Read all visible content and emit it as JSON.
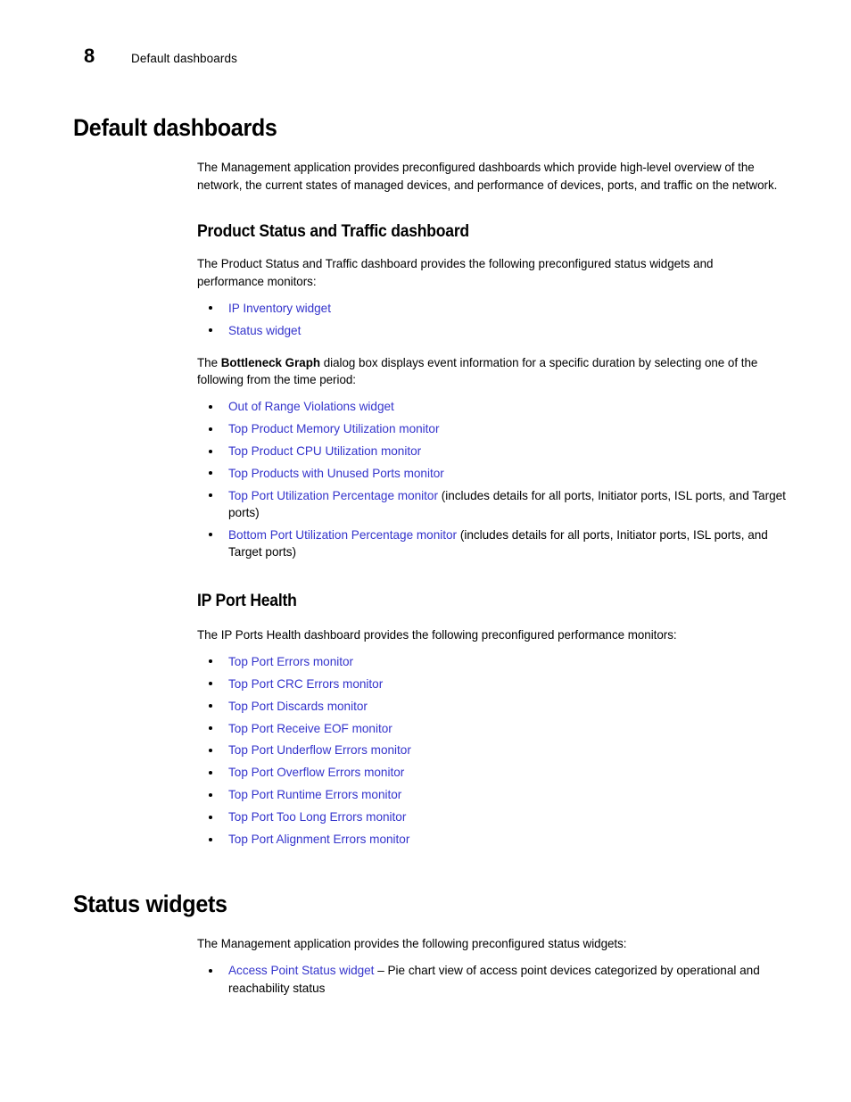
{
  "header": {
    "folio": "8",
    "running_title": "Default dashboards"
  },
  "chapter": {
    "title": "Default dashboards",
    "intro": "The Management application provides preconfigured dashboards which provide high-level overview of the network, the current states of managed devices, and performance of devices, ports, and traffic on the network."
  },
  "sections": [
    {
      "id": "product-status-and-traffic-dashboard",
      "title": "Product Status and Traffic dashboard",
      "intro": "The Product Status and Traffic dashboard provides the following preconfigured status widgets and performance monitors:",
      "list_one": [
        {
          "link": "IP Inventory widget",
          "rest": ""
        },
        {
          "link": "Status widget",
          "rest": ""
        }
      ],
      "mid_paragraph_pre": "The ",
      "mid_paragraph_bold": "Bottleneck Graph",
      "mid_paragraph_post": " dialog box displays event information for a specific duration by selecting one of the following from the time period:",
      "list_two": [
        {
          "link": "Out of Range Violations widget",
          "rest": ""
        },
        {
          "link": "Top Product Memory Utilization monitor",
          "rest": ""
        },
        {
          "link": "Top Product CPU Utilization monitor",
          "rest": ""
        },
        {
          "link": "Top Products with Unused Ports monitor",
          "rest": ""
        },
        {
          "link": "Top Port Utilization Percentage monitor",
          "rest": " (includes details for all ports, Initiator ports, ISL ports, and Target ports)"
        },
        {
          "link": "Bottom Port Utilization Percentage monitor",
          "rest": " (includes details for all ports, Initiator ports, ISL ports, and Target ports)"
        }
      ]
    },
    {
      "id": "ip-port-health",
      "title": "IP Port Health",
      "intro": "The IP Ports Health dashboard provides the following preconfigured performance monitors:",
      "list_one": [
        {
          "link": "Top Port Errors monitor",
          "rest": ""
        },
        {
          "link": "Top Port CRC Errors monitor",
          "rest": ""
        },
        {
          "link": "Top Port Discards monitor",
          "rest": ""
        },
        {
          "link": "Top Port Receive EOF monitor",
          "rest": ""
        },
        {
          "link": "Top Port Underflow Errors monitor",
          "rest": ""
        },
        {
          "link": "Top Port Overflow Errors monitor",
          "rest": ""
        },
        {
          "link": "Top Port Runtime Errors monitor",
          "rest": ""
        },
        {
          "link": "Top Port Too Long Errors monitor",
          "rest": ""
        },
        {
          "link": "Top Port Alignment Errors monitor",
          "rest": ""
        }
      ]
    }
  ],
  "chapter_two": {
    "title": "Status widgets",
    "intro": "The Management application provides the following preconfigured status widgets:",
    "list": [
      {
        "link": "Access Point Status widget",
        "rest": " – Pie chart view of access point devices categorized by operational and reachability status"
      }
    ]
  },
  "colors": {
    "link": "#3434CC",
    "text": "#000000",
    "page_background": "#FFFFFF"
  }
}
